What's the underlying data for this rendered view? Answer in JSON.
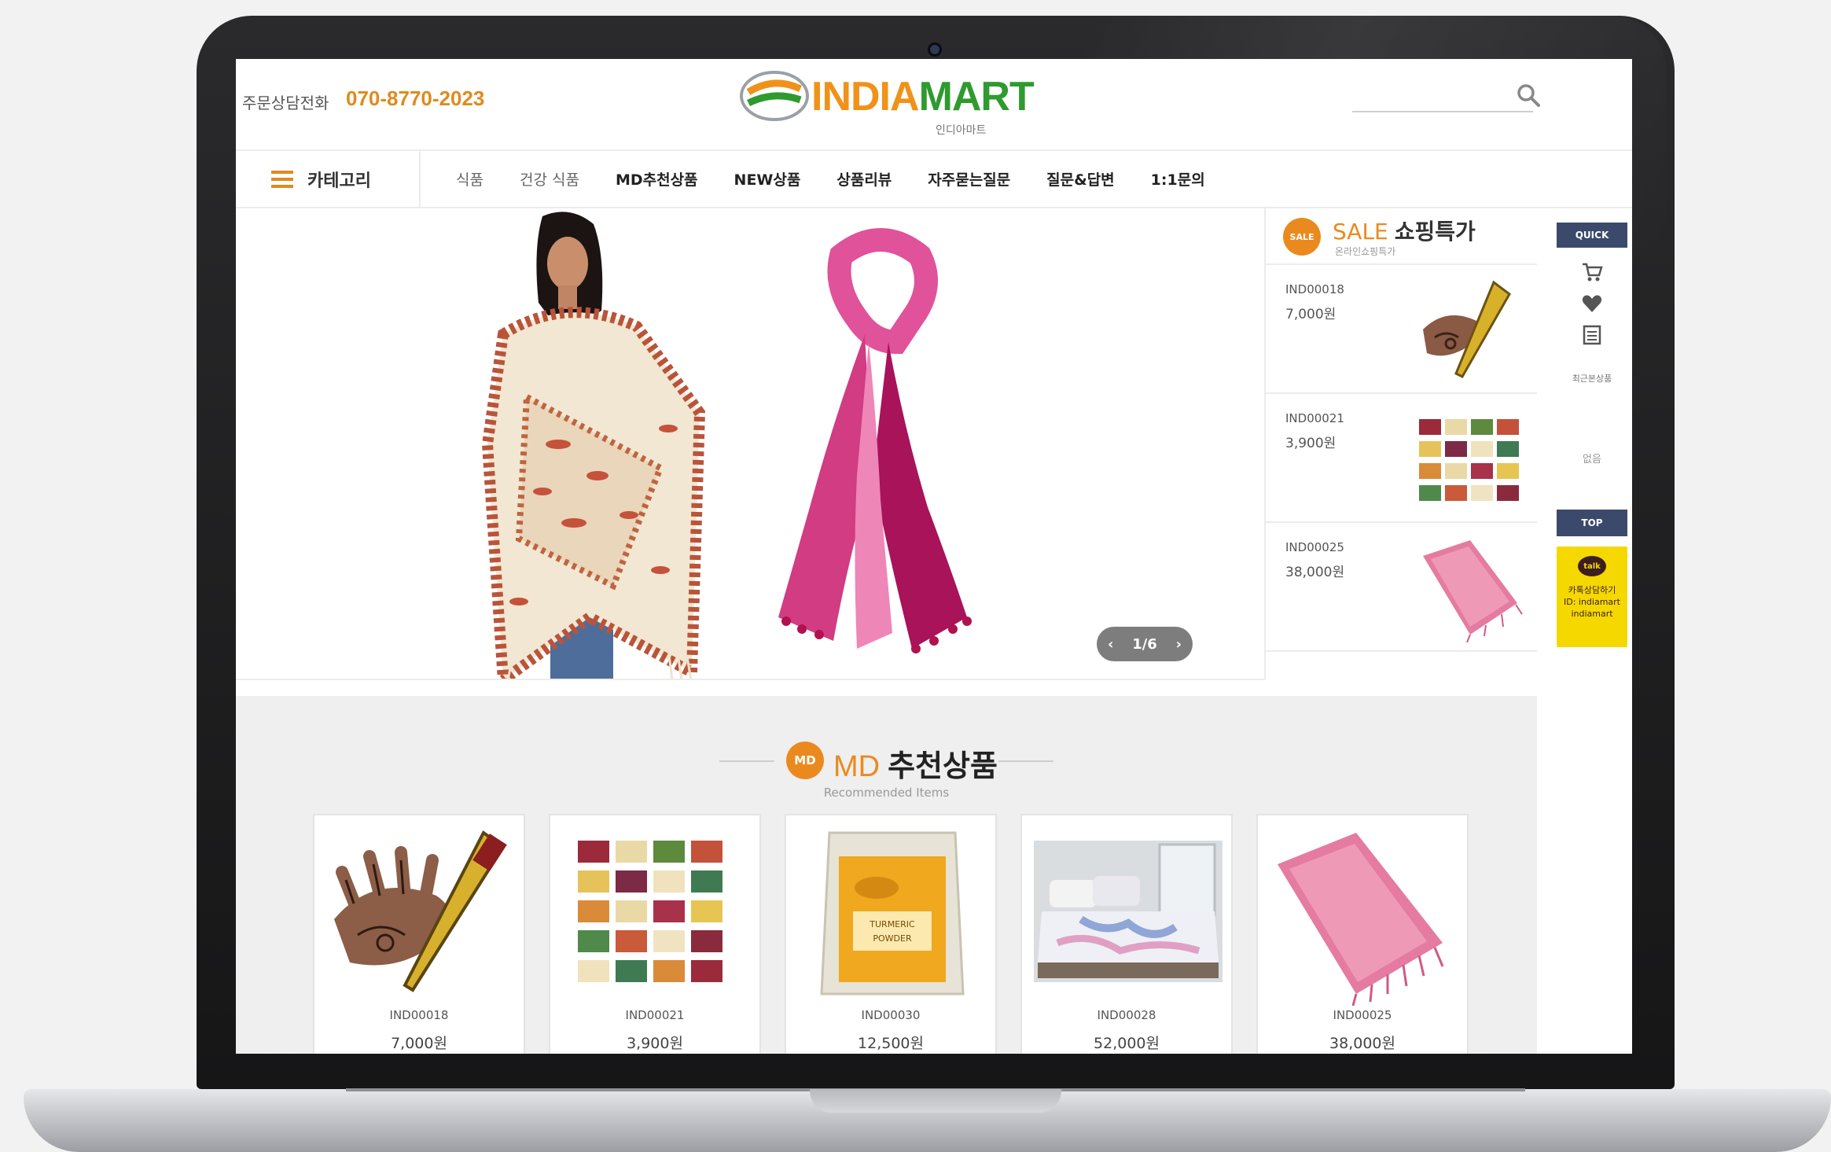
{
  "header": {
    "phone_label": "주문상담전화",
    "phone_number": "070-8770-2023",
    "logo_text_a": "INDIA",
    "logo_text_b": "MART",
    "logo_sub": "인디아마트"
  },
  "nav": {
    "category_label": "카테고리",
    "items": [
      {
        "label": "식품"
      },
      {
        "label": "건강 식품"
      },
      {
        "label": "MD추천상품"
      },
      {
        "label": "NEW상품"
      },
      {
        "label": "상품리뷰"
      },
      {
        "label": "자주묻는질문"
      },
      {
        "label": "질문&답변"
      },
      {
        "label": "1:1문의"
      }
    ]
  },
  "hero": {
    "pager": "1/6",
    "prev": "‹",
    "next": "›"
  },
  "sale": {
    "badge": "SALE",
    "title_en": "SALE",
    "title_ko": "쇼핑특가",
    "subtitle": "온라인쇼핑특가",
    "items": [
      {
        "code": "IND00018",
        "price": "7,000원",
        "icon": "henna-cone"
      },
      {
        "code": "IND00021",
        "price": "3,900원",
        "icon": "soap-bars"
      },
      {
        "code": "IND00025",
        "price": "38,000원",
        "icon": "pink-shawl"
      }
    ]
  },
  "quick": {
    "head": "QUICK",
    "recent": "최근본상품",
    "empty": "없음",
    "top": "TOP",
    "kakao_bubble": "talk",
    "kakao_line1": "카톡상담하기",
    "kakao_line2": "ID: indiamart",
    "kakao_line3": "indiamart"
  },
  "md": {
    "badge": "MD",
    "title_en": "MD",
    "title_ko": "추천상품",
    "subtitle": "Recommended Items",
    "products": [
      {
        "code": "IND00018",
        "price": "7,000원",
        "icon": "henna-cone"
      },
      {
        "code": "IND00021",
        "price": "3,900원",
        "icon": "soap-bars"
      },
      {
        "code": "IND00030",
        "price": "12,500원",
        "icon": "turmeric-powder"
      },
      {
        "code": "IND00028",
        "price": "52,000원",
        "icon": "bed-cover"
      },
      {
        "code": "IND00025",
        "price": "38,000원",
        "icon": "pink-shawl"
      }
    ]
  },
  "colors": {
    "accent_orange": "#ea8a1e",
    "logo_green": "#2f9a2f",
    "quick_navy": "#3b4a6b",
    "kakao_yellow": "#f5d800"
  }
}
